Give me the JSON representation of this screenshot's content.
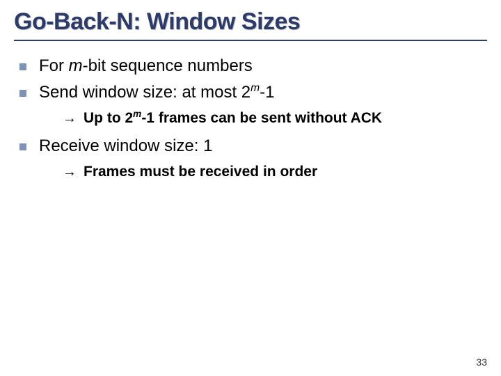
{
  "title": "Go-Back-N: Window Sizes",
  "items": [
    {
      "prefix": "For ",
      "ital1": "m",
      "rest": "-bit sequence numbers"
    },
    {
      "prefix": "Send window size: at most 2",
      "sup": "m",
      "rest": "-1",
      "sub": {
        "prefix": "Up to 2",
        "sup": "m",
        "rest": "-1 frames can be sent without ACK"
      }
    },
    {
      "prefix": "Receive window size: 1",
      "sub": {
        "prefix": "Frames must be received in order"
      }
    }
  ],
  "page": "33"
}
